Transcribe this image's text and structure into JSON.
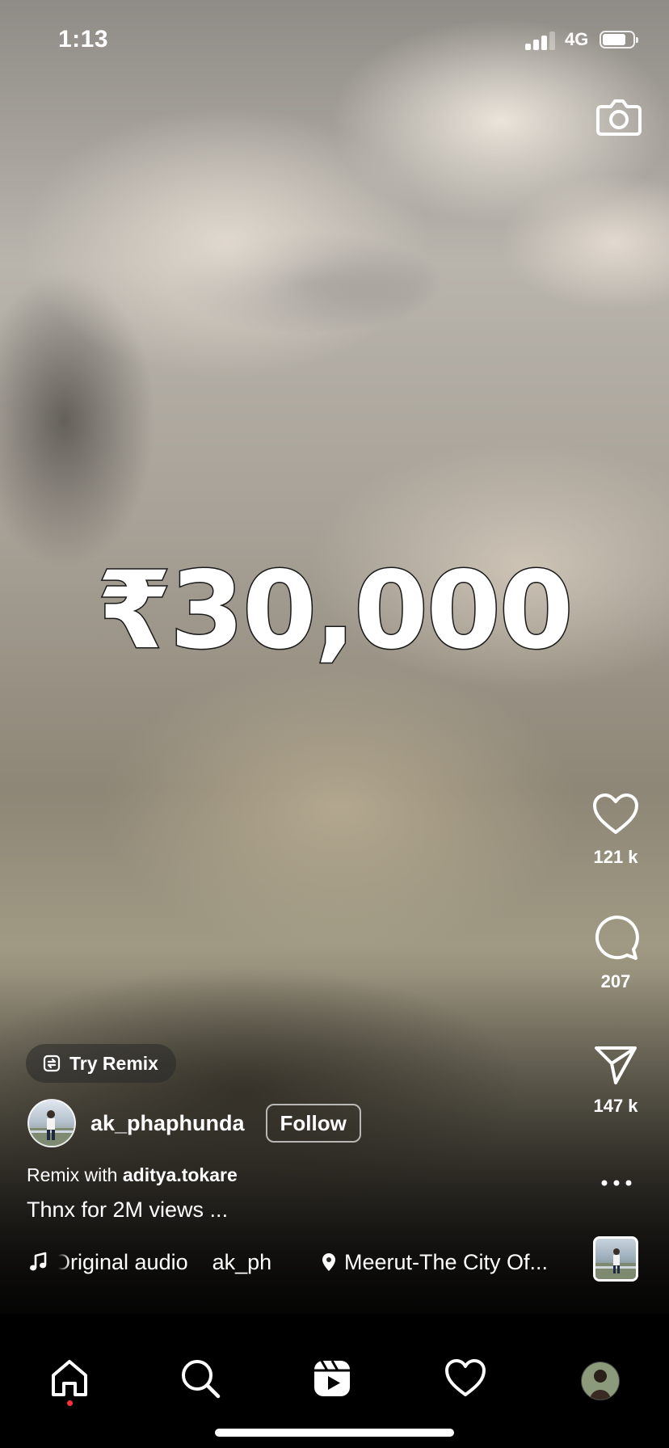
{
  "status_bar": {
    "time": "1:13",
    "network": "4G",
    "signal_bars_active": 3,
    "battery_level": 0.7
  },
  "video": {
    "overlay_text": "₹30,000"
  },
  "actions": {
    "likes": "121 k",
    "comments": "207",
    "shares": "147 k"
  },
  "remix": {
    "pill_label": "Try Remix",
    "with_prefix": "Remix with",
    "with_user": "aditya.tokare"
  },
  "post": {
    "username": "ak_phaphunda",
    "follow_label": "Follow",
    "caption": "Thnx for 2M views ..."
  },
  "audio": {
    "track": "Original audio",
    "artist": "ak_ph",
    "location": "Meerut-The City Of..."
  },
  "icons": {
    "camera": "camera-icon",
    "like": "heart-icon",
    "comment": "comment-bubble-icon",
    "share": "paper-plane-icon",
    "more": "more-horizontal-icon",
    "music": "music-note-icon",
    "location": "location-pin-icon",
    "remix": "remix-icon",
    "tabs": [
      "home-icon",
      "search-icon",
      "reels-icon",
      "heart-icon",
      "profile-avatar"
    ]
  },
  "colors": {
    "notification_dot": "#ff3040",
    "tab_bar_background": "#000000"
  }
}
